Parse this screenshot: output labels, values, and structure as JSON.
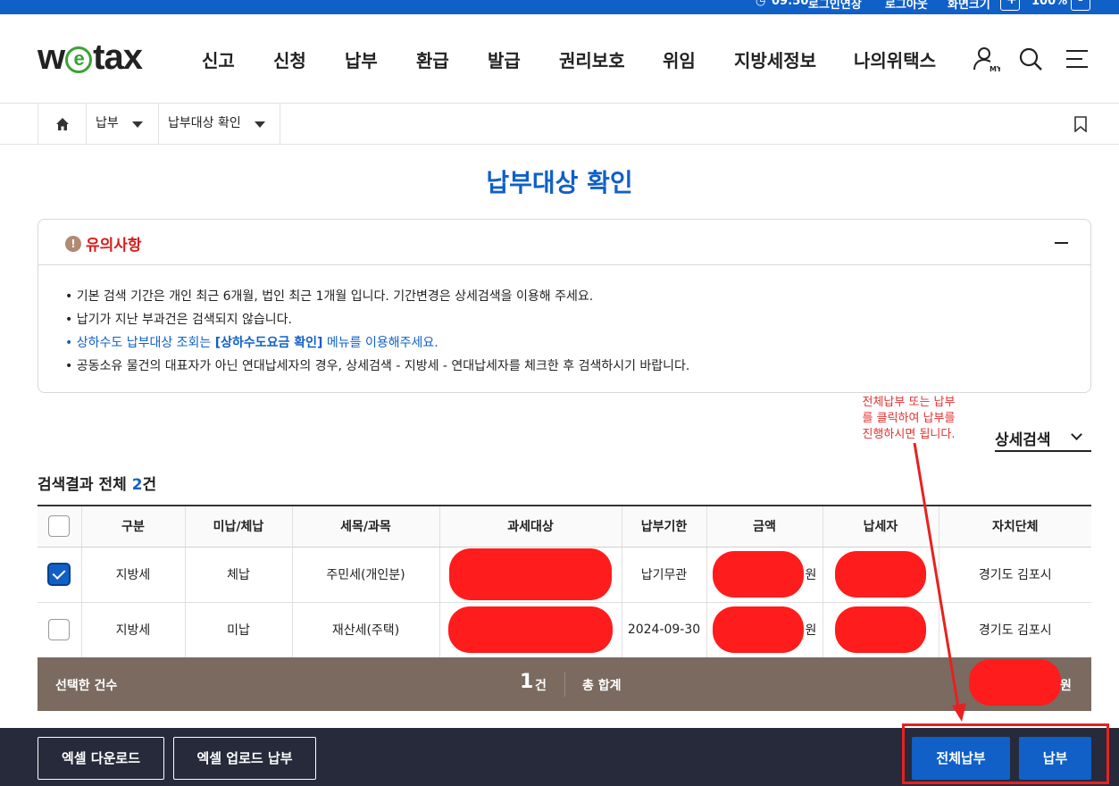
{
  "topbar": {
    "time": "09:50",
    "extend": "로그인연장",
    "logout": "로그아웃",
    "zoom_label": "화면크기",
    "zoom_plus": "+",
    "zoom_value": "100%",
    "zoom_minus": "-"
  },
  "header": {
    "logo_left": "w",
    "logo_e": "e",
    "logo_right": "tax",
    "nav": [
      "신고",
      "신청",
      "납부",
      "환급",
      "발급",
      "권리보호",
      "위임",
      "지방세정보",
      "나의위택스"
    ],
    "my_label": "MY"
  },
  "breadcrumb": {
    "level1": "납부",
    "level2": "납부대상 확인"
  },
  "page_title": "납부대상 확인",
  "notice": {
    "title": "유의사항",
    "icon_glyph": "!",
    "items": [
      "기본 검색 기간은 개인 최근 6개월, 법인 최근 1개월 입니다. 기간변경은 상세검색을 이용해 주세요.",
      "납기가 지난 부과건은 검색되지 않습니다."
    ],
    "link_item": {
      "prefix": "상하수도 납부대상 조회는 ",
      "link": "[상하수도요금 확인]",
      "suffix": " 메뉴를 이용해주세요."
    },
    "last_item": "공동소유 물건의 대표자가 아닌 연대납세자의 경우, 상세검색 - 지방세 - 연대납세자를 체크한 후 검색하시기 바랍니다."
  },
  "annotation": [
    "전체납부 또는 납부",
    "를 클릭하여 납부를",
    "진행하시면 됩니다."
  ],
  "detail_search": "상세검색",
  "result": {
    "prefix": "검색결과 전체 ",
    "count": "2",
    "suffix": "건"
  },
  "table": {
    "headers": [
      "구분",
      "미납/체납",
      "세목/과목",
      "과세대상",
      "납부기한",
      "금액",
      "납세자",
      "자치단체"
    ],
    "rows": [
      {
        "checked": true,
        "type": "지방세",
        "status": "체납",
        "tax_item": "주민세(개인분)",
        "due": "납기무관",
        "won": "원",
        "authority": "경기도 김포시"
      },
      {
        "checked": false,
        "type": "지방세",
        "status": "미납",
        "tax_item": "재산세(주택)",
        "due": "2024-09-30",
        "won": "원",
        "authority": "경기도 김포시"
      }
    ]
  },
  "total": {
    "selected_label": "선택한 건수",
    "selected_count": "1",
    "count_unit": "건",
    "sum_label": "총 합계",
    "won": "원"
  },
  "actions": {
    "excel_download": "엑셀 다운로드",
    "excel_upload_pay": "엑셀 업로드 납부",
    "pay_all": "전체납부",
    "pay": "납부"
  },
  "colors": {
    "brand_blue": "#1060c8",
    "alert_red": "#d81b1b",
    "total_bar": "#7a6a60",
    "action_bar": "#262a3a",
    "redaction": "#ff1c1c"
  }
}
